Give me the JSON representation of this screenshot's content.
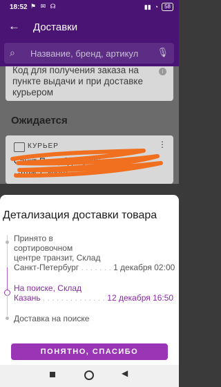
{
  "status_bar": {
    "time": "18:52",
    "battery": "58"
  },
  "header": {
    "title": "Доставки"
  },
  "search": {
    "placeholder": "Название, бренд, артикул"
  },
  "background": {
    "code_text": "Код для получения заказа на пункте выдачи и при доставке курьером",
    "section_title": "Ожидается",
    "courier_label": "КУРЬЕР",
    "address_line1": "Санкт-Петербург, улица",
    "address_line2": "",
    "address_line3": ", этаж 1, кварт"
  },
  "sheet": {
    "title": "Детализация доставки товара",
    "steps": [
      {
        "lines": [
          "Принято в",
          "сортировочном",
          "центре транзит, Склад"
        ],
        "place": "Санкт-Петербург",
        "date": "1 декабря 02:00"
      },
      {
        "lines": [
          "На поиске, Склад"
        ],
        "place": "Казань",
        "date": "12 декабря 16:50"
      },
      {
        "lines": [
          "Доставка на поиске"
        ]
      }
    ],
    "button_label": "ПОНЯТНО, СПАСИБО"
  },
  "colors": {
    "brand": "#4a1474",
    "accent": "#9a35b6",
    "highlight": "#8a2aa6",
    "scribble": "#f07020"
  }
}
